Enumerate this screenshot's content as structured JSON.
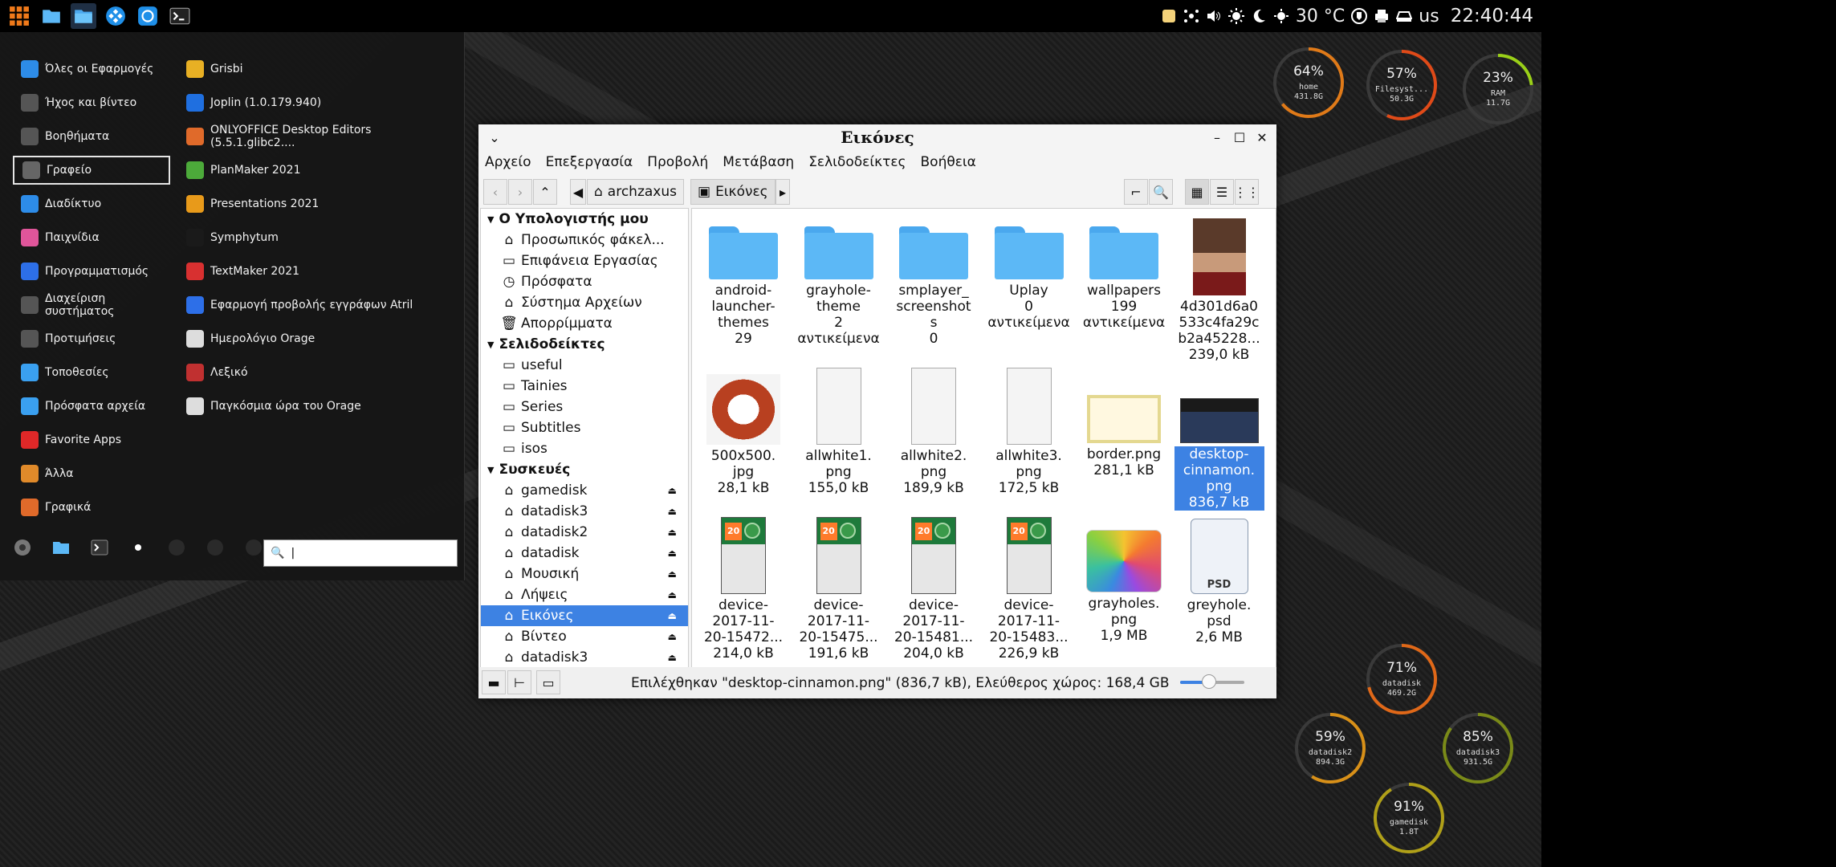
{
  "panel": {
    "temperature": "30 °C",
    "keyboard_layout": "us",
    "clock": "22:40:44"
  },
  "menu": {
    "categories": [
      {
        "label": "Όλες οι Εφαρμογές",
        "color": "#2d8ce8"
      },
      {
        "label": "Ήχος και βίντεο",
        "color": "#555555"
      },
      {
        "label": "Βοηθήματα",
        "color": "#555555"
      },
      {
        "label": "Γραφείο",
        "color": "#666666"
      },
      {
        "label": "Διαδίκτυο",
        "color": "#2d8ce8"
      },
      {
        "label": "Παιχνίδια",
        "color": "#e0559a"
      },
      {
        "label": "Προγραμματισμός",
        "color": "#2d6fe8"
      },
      {
        "label": "Διαχείριση συστήματος",
        "color": "#555555"
      },
      {
        "label": "Προτιμήσεις",
        "color": "#555555"
      },
      {
        "label": "Τοποθεσίες",
        "color": "#3aa0f0"
      },
      {
        "label": "Πρόσφατα αρχεία",
        "color": "#3aa0f0"
      },
      {
        "label": "Favorite Apps",
        "color": "#e02828"
      },
      {
        "label": "Άλλα",
        "color": "#e08a2a"
      },
      {
        "label": "Γραφικά",
        "color": "#e06a2a"
      }
    ],
    "apps": [
      {
        "label": "Grisbi",
        "color": "#e8b024"
      },
      {
        "label": "Joplin (1.0.179.940)",
        "color": "#1f6fe0"
      },
      {
        "label": "ONLYOFFICE Desktop Editors (5.5.1.glibc2....",
        "color": "#e06a2a"
      },
      {
        "label": "PlanMaker 2021",
        "color": "#4caa3a"
      },
      {
        "label": "Presentations 2021",
        "color": "#e89a1a"
      },
      {
        "label": "Symphytum",
        "color": "#1a1a1a"
      },
      {
        "label": "TextMaker 2021",
        "color": "#d83030"
      },
      {
        "label": "Εφαρμογή προβολής εγγράφων Atril",
        "color": "#2d6fe8"
      },
      {
        "label": "Ημερολόγιο Orage",
        "color": "#dddddd"
      },
      {
        "label": "Λεξικό",
        "color": "#c03030"
      },
      {
        "label": "Παγκόσμια ώρα του Orage",
        "color": "#dddddd"
      }
    ],
    "search_value": "|"
  },
  "fm": {
    "title": "Εικόνες",
    "menus": [
      "Αρχείο",
      "Επεξεργασία",
      "Προβολή",
      "Μετάβαση",
      "Σελιδοδείκτες",
      "Βοήθεια"
    ],
    "path": [
      "archzaxus",
      "Εικόνες"
    ],
    "sidebar": [
      {
        "type": "head",
        "label": "Ο Υπολογιστής μου"
      },
      {
        "type": "item",
        "label": "Προσωπικός φάκελ...",
        "icon": "home"
      },
      {
        "type": "item",
        "label": "Επιφάνεια Εργασίας",
        "icon": "desktop"
      },
      {
        "type": "item",
        "label": "Πρόσφατα",
        "icon": "recent"
      },
      {
        "type": "item",
        "label": "Σύστημα Αρχείων",
        "icon": "drive"
      },
      {
        "type": "item",
        "label": "Απορρίμματα",
        "icon": "trash"
      },
      {
        "type": "head",
        "label": "Σελιδοδείκτες"
      },
      {
        "type": "item",
        "label": "useful",
        "icon": "folder"
      },
      {
        "type": "item",
        "label": "Tainies",
        "icon": "folder"
      },
      {
        "type": "item",
        "label": "Series",
        "icon": "folder"
      },
      {
        "type": "item",
        "label": "Subtitles",
        "icon": "folder"
      },
      {
        "type": "item",
        "label": "isos",
        "icon": "folder"
      },
      {
        "type": "head",
        "label": "Συσκευές"
      },
      {
        "type": "item",
        "label": "gamedisk",
        "icon": "drive",
        "eject": true
      },
      {
        "type": "item",
        "label": "datadisk3",
        "icon": "drive",
        "eject": true
      },
      {
        "type": "item",
        "label": "datadisk2",
        "icon": "drive",
        "eject": true
      },
      {
        "type": "item",
        "label": "datadisk",
        "icon": "drive",
        "eject": true
      },
      {
        "type": "item",
        "label": "Μουσική",
        "icon": "drive",
        "eject": true
      },
      {
        "type": "item",
        "label": "Λήψεις",
        "icon": "drive",
        "eject": true
      },
      {
        "type": "item",
        "label": "Εικόνες",
        "icon": "drive",
        "eject": true,
        "selected": true
      },
      {
        "type": "item",
        "label": "Βίντεο",
        "icon": "drive",
        "eject": true
      },
      {
        "type": "item",
        "label": "datadisk3",
        "icon": "drive",
        "eject": true
      }
    ],
    "files": [
      {
        "kind": "folder",
        "lines": [
          "android-",
          "launcher-",
          "themes",
          "29"
        ]
      },
      {
        "kind": "folder",
        "lines": [
          "grayhole-",
          "theme",
          "2",
          "αντικείμενα"
        ]
      },
      {
        "kind": "folder",
        "lines": [
          "smplayer_",
          "screenshot",
          "s",
          "0"
        ]
      },
      {
        "kind": "folder",
        "lines": [
          "Uplay",
          "0",
          "αντικείμενα"
        ]
      },
      {
        "kind": "folder",
        "lines": [
          "wallpapers",
          "199",
          "αντικείμενα"
        ]
      },
      {
        "kind": "portrait",
        "lines": [
          "4d301d6a0",
          "533c4fa29c",
          "b2a45228...",
          "239,0 kB"
        ]
      },
      {
        "kind": "fangs",
        "lines": [
          "500x500.",
          "jpg",
          "28,1 kB"
        ]
      },
      {
        "kind": "phone",
        "lines": [
          "allwhite1.",
          "png",
          "155,0 kB"
        ]
      },
      {
        "kind": "phone",
        "lines": [
          "allwhite2.",
          "png",
          "189,9 kB"
        ]
      },
      {
        "kind": "phone",
        "lines": [
          "allwhite3.",
          "png",
          "172,5 kB"
        ]
      },
      {
        "kind": "border",
        "lines": [
          "border.png",
          "281,1 kB"
        ]
      },
      {
        "kind": "screen",
        "lines": [
          "desktop-",
          "cinnamon.",
          "png",
          "836,7 kB"
        ],
        "selected": true
      },
      {
        "kind": "phone-green",
        "lines": [
          "device-",
          "2017-11-",
          "20-15472...",
          "214,0 kB"
        ]
      },
      {
        "kind": "phone-green",
        "lines": [
          "device-",
          "2017-11-",
          "20-15475...",
          "191,6 kB"
        ]
      },
      {
        "kind": "phone-green",
        "lines": [
          "device-",
          "2017-11-",
          "20-15481...",
          "204,0 kB"
        ]
      },
      {
        "kind": "phone-green",
        "lines": [
          "device-",
          "2017-11-",
          "20-15483...",
          "226,9 kB"
        ]
      },
      {
        "kind": "photos",
        "lines": [
          "grayholes.",
          "png",
          "1,9 MB"
        ]
      },
      {
        "kind": "psd",
        "lines": [
          "greyhole.",
          "psd",
          "2,6 MB"
        ]
      }
    ],
    "status": "Επιλέχθηκαν \"desktop-cinnamon.png\" (836,7 kB), Ελεύθερος χώρος: 168,4 GB",
    "zoom_fraction": 0.45
  },
  "gauges": [
    {
      "pct": "64%",
      "name": "home",
      "size": "431.8G",
      "value": 0.64,
      "color": "#e07a18"
    },
    {
      "pct": "57%",
      "name": "Filesyst...",
      "size": "50.3G",
      "value": 0.57,
      "color": "#e04a18"
    },
    {
      "pct": "23%",
      "name": "RAM",
      "size": "11.7G",
      "value": 0.23,
      "color": "#9ad018"
    },
    {
      "pct": "71%",
      "name": "datadisk",
      "size": "469.2G",
      "value": 0.71,
      "color": "#e06818"
    },
    {
      "pct": "59%",
      "name": "datadisk2",
      "size": "894.3G",
      "value": 0.59,
      "color": "#d89018"
    },
    {
      "pct": "85%",
      "name": "datadisk3",
      "size": "931.5G",
      "value": 0.85,
      "color": "#7a8a18"
    },
    {
      "pct": "91%",
      "name": "gamedisk",
      "size": "1.8T",
      "value": 0.91,
      "color": "#b0a018"
    }
  ]
}
